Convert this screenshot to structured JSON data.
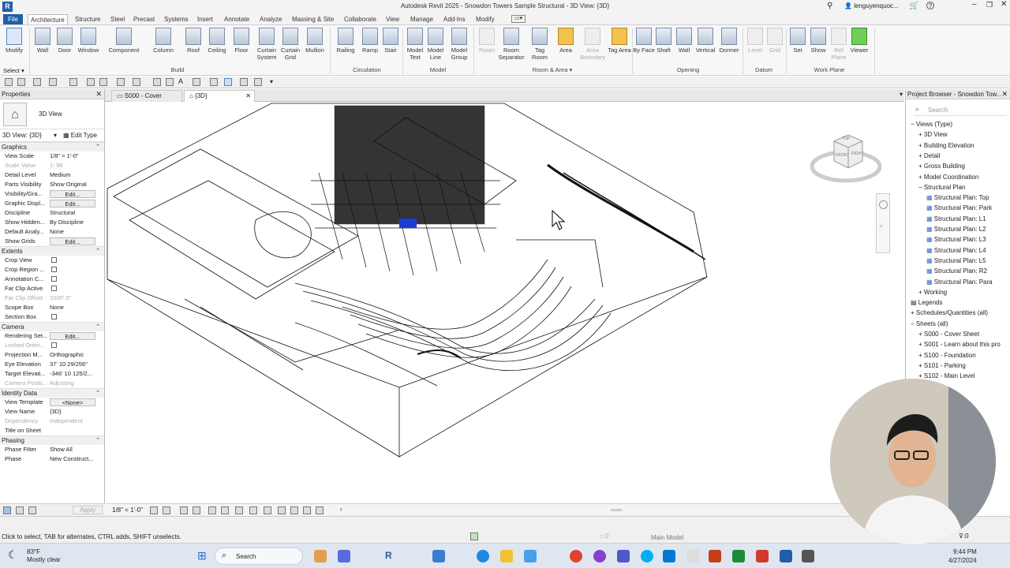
{
  "window": {
    "title": "Autodesk Revit 2025 - Snowdon Towers Sample Structural - 3D View: {3D}",
    "app_icon": "R",
    "user": "lenguyenquoc...",
    "help": "?"
  },
  "menu": {
    "tabs": [
      "File",
      "Architecture",
      "Structure",
      "Steel",
      "Precast",
      "Systems",
      "Insert",
      "Annotate",
      "Analyze",
      "Massing & Site",
      "Collaborate",
      "View",
      "Manage",
      "Add-Ins",
      "Modify"
    ],
    "active": "Architecture"
  },
  "ribbon": {
    "modify": {
      "label": "Modify",
      "select": "Select"
    },
    "build": {
      "panel": "Build",
      "buttons": [
        "Wall",
        "Door",
        "Window",
        "Component",
        "Column",
        "Roof",
        "Ceiling",
        "Floor",
        "Curtain System",
        "Curtain Grid",
        "Mullion"
      ]
    },
    "circulation": {
      "panel": "Circulation",
      "buttons": [
        "Railing",
        "Ramp",
        "Stair"
      ]
    },
    "model": {
      "panel": "Model",
      "buttons": [
        "Model Text",
        "Model Line",
        "Model Group"
      ]
    },
    "room_area": {
      "panel": "Room & Area",
      "buttons": [
        "Room",
        "Room Separator",
        "Tag Room",
        "Area",
        "Area Boundary",
        "Tag Area"
      ]
    },
    "opening": {
      "panel": "Opening",
      "buttons": [
        "By Face",
        "Shaft",
        "Wall",
        "Vertical",
        "Dormer"
      ]
    },
    "datum": {
      "panel": "Datum",
      "buttons": [
        "Level",
        "Grid"
      ]
    },
    "work_plane": {
      "panel": "Work Plane",
      "buttons": [
        "Set",
        "Show",
        "Ref Plane",
        "Viewer"
      ]
    }
  },
  "properties": {
    "title": "Properties",
    "type_name": "3D View",
    "selector": "3D View: {3D}",
    "edit_type": "Edit Type",
    "sections": [
      {
        "name": "Graphics",
        "rows": [
          {
            "k": "View Scale",
            "v": "1/8\" = 1'-0\""
          },
          {
            "k": "Scale Value",
            "v": "1: 96",
            "dim": true
          },
          {
            "k": "Detail Level",
            "v": "Medium"
          },
          {
            "k": "Parts Visibility",
            "v": "Show Original"
          },
          {
            "k": "Visibility/Gra...",
            "v": "Edit...",
            "btn": true
          },
          {
            "k": "Graphic Displ...",
            "v": "Edit...",
            "btn": true
          },
          {
            "k": "Discipline",
            "v": "Structural"
          },
          {
            "k": "Show Hidden...",
            "v": "By Discipline"
          },
          {
            "k": "Default Analy...",
            "v": "None"
          },
          {
            "k": "Show Grids",
            "v": "Edit...",
            "btn": true
          }
        ]
      },
      {
        "name": "Extents",
        "rows": [
          {
            "k": "Crop View",
            "v": "",
            "cb": true
          },
          {
            "k": "Crop Region ...",
            "v": "",
            "cb": true
          },
          {
            "k": "Annotation C...",
            "v": "",
            "cb": true
          },
          {
            "k": "Far Clip Active",
            "v": "",
            "cb": true
          },
          {
            "k": "Far Clip Offset",
            "v": "1000' 0\"",
            "dim": true
          },
          {
            "k": "Scope Box",
            "v": "None"
          },
          {
            "k": "Section Box",
            "v": "",
            "cb": true
          }
        ]
      },
      {
        "name": "Camera",
        "rows": [
          {
            "k": "Rendering Set...",
            "v": "Edit...",
            "btn": true
          },
          {
            "k": "Locked Orien...",
            "v": "",
            "cb": true,
            "dim": true
          },
          {
            "k": "Projection M...",
            "v": "Orthographic"
          },
          {
            "k": "Eye Elevation",
            "v": "37' 10 29/256\""
          },
          {
            "k": "Target Elevati...",
            "v": "-346' 10 125/2..."
          },
          {
            "k": "Camera Positi...",
            "v": "Adjusting",
            "dim": true
          }
        ]
      },
      {
        "name": "Identity Data",
        "rows": [
          {
            "k": "View Template",
            "v": "<None>",
            "btn": true
          },
          {
            "k": "View Name",
            "v": "{3D}"
          },
          {
            "k": "Dependency",
            "v": "Independent",
            "dim": true
          },
          {
            "k": "Title on Sheet",
            "v": ""
          }
        ]
      },
      {
        "name": "Phasing",
        "rows": [
          {
            "k": "Phase Filter",
            "v": "Show All"
          },
          {
            "k": "Phase",
            "v": "New Construct..."
          }
        ]
      }
    ],
    "apply": "Apply"
  },
  "view_tabs": [
    {
      "label": "S000 - Cover Sheet",
      "active": false
    },
    {
      "label": "{3D}",
      "active": true
    }
  ],
  "view_control": {
    "scale": "1/8\" = 1'-0\""
  },
  "viewcube": {
    "top": "TOP",
    "front": "FRONT",
    "right": "RIGHT"
  },
  "project_browser": {
    "title": "Project Browser - Snowdon Tow...",
    "search_placeholder": "Search",
    "items": [
      {
        "label": "Views (Type)",
        "lvl": 0,
        "tg": "−"
      },
      {
        "label": "3D View",
        "lvl": 1,
        "tg": "+"
      },
      {
        "label": "Building Elevation",
        "lvl": 1,
        "tg": "+"
      },
      {
        "label": "Detail",
        "lvl": 1,
        "tg": "+"
      },
      {
        "label": "Gross Building",
        "lvl": 1,
        "tg": "+"
      },
      {
        "label": "Model Coordination",
        "lvl": 1,
        "tg": "+"
      },
      {
        "label": "Structural Plan",
        "lvl": 1,
        "tg": "−"
      },
      {
        "label": "Structural Plan: Top",
        "lvl": 2
      },
      {
        "label": "Structural Plan: Park",
        "lvl": 2
      },
      {
        "label": "Structural Plan: L1",
        "lvl": 2
      },
      {
        "label": "Structural Plan: L2",
        "lvl": 2
      },
      {
        "label": "Structural Plan: L3",
        "lvl": 2
      },
      {
        "label": "Structural Plan: L4",
        "lvl": 2
      },
      {
        "label": "Structural Plan: L5",
        "lvl": 2
      },
      {
        "label": "Structural Plan: R2",
        "lvl": 2
      },
      {
        "label": "Structural Plan: Para",
        "lvl": 2
      },
      {
        "label": "Working",
        "lvl": 1,
        "tg": "+"
      },
      {
        "label": "Legends",
        "lvl": 0
      },
      {
        "label": "Schedules/Quantities (all)",
        "lvl": 0,
        "tg": "+"
      },
      {
        "label": "Sheets (all)",
        "lvl": 0,
        "tg": "−"
      },
      {
        "label": "S000 - Cover Sheet",
        "lvl": 1,
        "tg": "+"
      },
      {
        "label": "S001 - Learn about this pro",
        "lvl": 1,
        "tg": "+"
      },
      {
        "label": "S100 - Foundation",
        "lvl": 1,
        "tg": "+"
      },
      {
        "label": "S101 - Parking",
        "lvl": 1,
        "tg": "+"
      },
      {
        "label": "S102 - Main Level",
        "lvl": 1,
        "tg": "+"
      }
    ]
  },
  "status": {
    "hint": "Click to select, TAB for alternates, CTRL adds, SHIFT unselects.",
    "model": "Main Model",
    "filter_count": ":0"
  },
  "taskbar": {
    "temp": "83°F",
    "weather": "Mostly clear",
    "search": "Search",
    "time": "9:44 PM",
    "date": "4/27/2024"
  }
}
